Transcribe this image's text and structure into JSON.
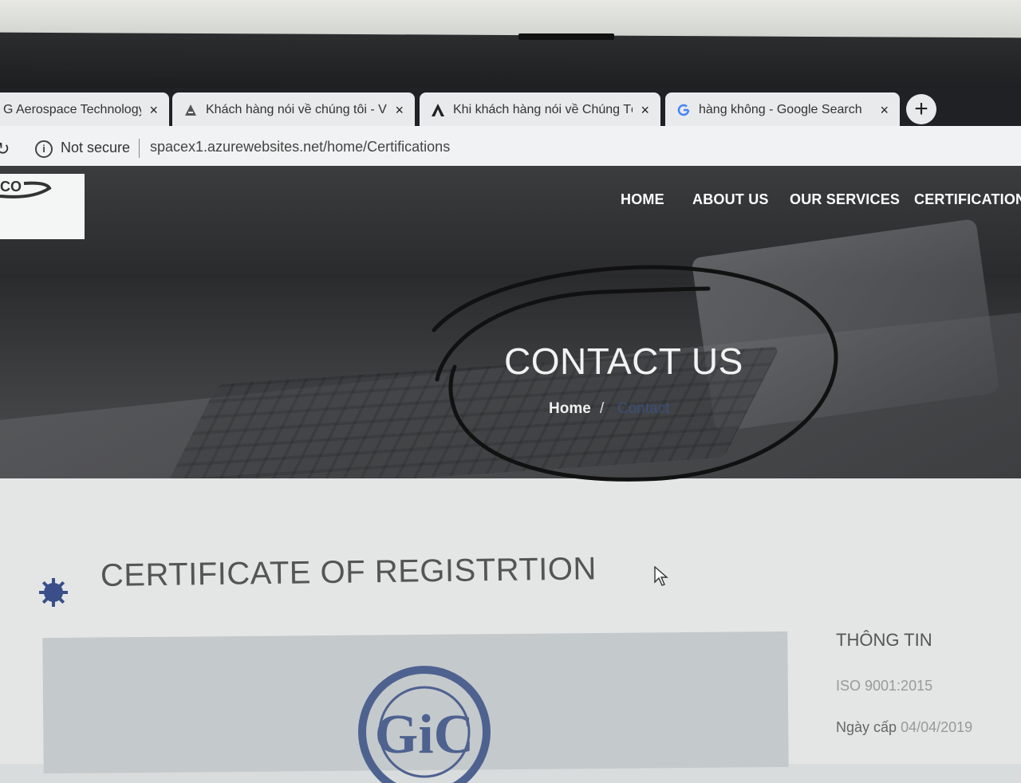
{
  "tabs": [
    {
      "title": "G Aerospace Technology",
      "close": "×"
    },
    {
      "title": "Khách hàng nói về chúng tôi - Vi",
      "close": "×"
    },
    {
      "title": "Khi khách hàng nói về Chúng Tôi",
      "close": "×"
    },
    {
      "title": "hàng không - Google Search",
      "close": "×"
    }
  ],
  "new_tab_label": "+",
  "address": {
    "security_label": "Not secure",
    "url": "spacex1.azurewebsites.net/home/Certifications"
  },
  "site": {
    "logo_text": "CO",
    "nav": [
      "HOME",
      "ABOUT US",
      "OUR SERVICES",
      "CERTIFICATION"
    ],
    "hero_title": "CONTACT US",
    "breadcrumb": {
      "home": "Home",
      "separator": "/",
      "current": "Contact"
    },
    "section_title": "CERTIFICATE OF REGISTRTION",
    "sidebar": {
      "heading": "THÔNG TIN",
      "standard": "ISO 9001:2015",
      "issue_label": "Ngày cấp",
      "issue_date": "04/04/2019"
    },
    "seal_text": "GiC"
  },
  "colors": {
    "accent_icon": "#3a4f8a",
    "nav_text": "#ffffff",
    "tabstrip": "#202124"
  }
}
